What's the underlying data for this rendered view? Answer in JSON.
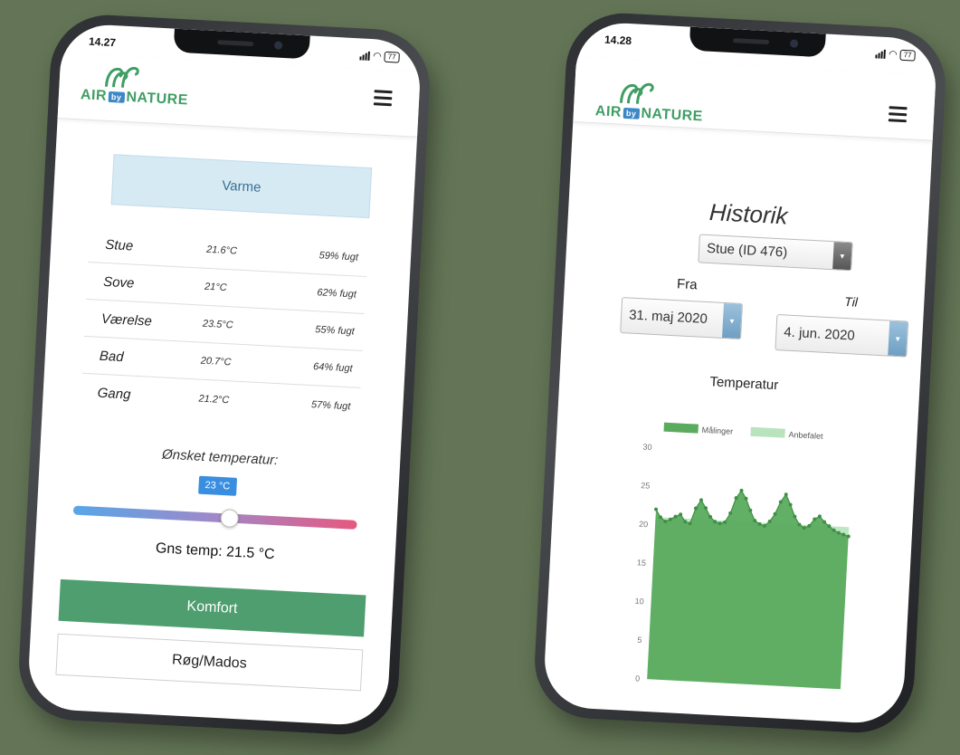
{
  "phone_left": {
    "status": {
      "time": "14.27",
      "battery": "77"
    },
    "logo": {
      "air": "AIR",
      "by": "by",
      "nature": "NATURE"
    },
    "varme_label": "Varme",
    "rooms": [
      {
        "name": "Stue",
        "temp": "21.6°C",
        "humidity": "59% fugt"
      },
      {
        "name": "Sove",
        "temp": "21°C",
        "humidity": "62% fugt"
      },
      {
        "name": "Værelse",
        "temp": "23.5°C",
        "humidity": "55% fugt"
      },
      {
        "name": "Bad",
        "temp": "20.7°C",
        "humidity": "64% fugt"
      },
      {
        "name": "Gang",
        "temp": "21.2°C",
        "humidity": "57% fugt"
      }
    ],
    "desired_label": "Ønsket temperatur:",
    "slider": {
      "value_label": "23 °C",
      "level": 0.55
    },
    "avg_temp": "Gns temp: 21.5 °C",
    "buttons": {
      "komfort": "Komfort",
      "rog": "Røg/Mados"
    }
  },
  "phone_right": {
    "status": {
      "time": "14.28",
      "battery": "77"
    },
    "logo": {
      "air": "AIR",
      "by": "by",
      "nature": "NATURE"
    },
    "title": "Historik",
    "room_select": "Stue (ID 476)",
    "from_label": "Fra",
    "to_label": "Til",
    "from_date": "31. maj 2020",
    "to_date": "4. jun. 2020",
    "chart_heading": "Temperatur"
  },
  "chart_data": {
    "type": "area",
    "title": "Temperatur",
    "ylim": [
      0,
      30
    ],
    "yticks": [
      "0",
      "5",
      "10",
      "15",
      "20",
      "25",
      "30"
    ],
    "grid": false,
    "legend": "top",
    "series": [
      {
        "name": "Målinger",
        "color": "#5aab5e",
        "values": [
          22,
          21,
          20.5,
          20.8,
          21.2,
          21.5,
          20.6,
          20.4,
          22.4,
          23.5,
          22.5,
          21.4,
          20.8,
          20.6,
          20.8,
          22,
          24,
          25,
          24,
          22.5,
          21.2,
          20.8,
          20.6,
          21.2,
          22.2,
          23.8,
          24.8,
          23.5,
          22,
          21,
          20.6,
          20.9,
          21.8,
          22.2,
          21.5,
          21,
          20.5,
          20.2,
          20,
          19.8
        ]
      },
      {
        "name": "Anbefalet",
        "color": "#b8e3bd",
        "values": [
          21,
          21,
          21,
          21,
          21,
          21,
          21,
          21,
          21,
          21,
          21,
          21,
          21,
          21,
          21,
          21,
          21,
          21,
          21,
          21,
          21,
          21,
          21,
          21,
          21,
          21,
          21,
          21,
          21,
          21,
          21,
          21,
          21,
          21,
          21,
          21,
          21,
          21,
          21,
          21
        ]
      }
    ]
  }
}
